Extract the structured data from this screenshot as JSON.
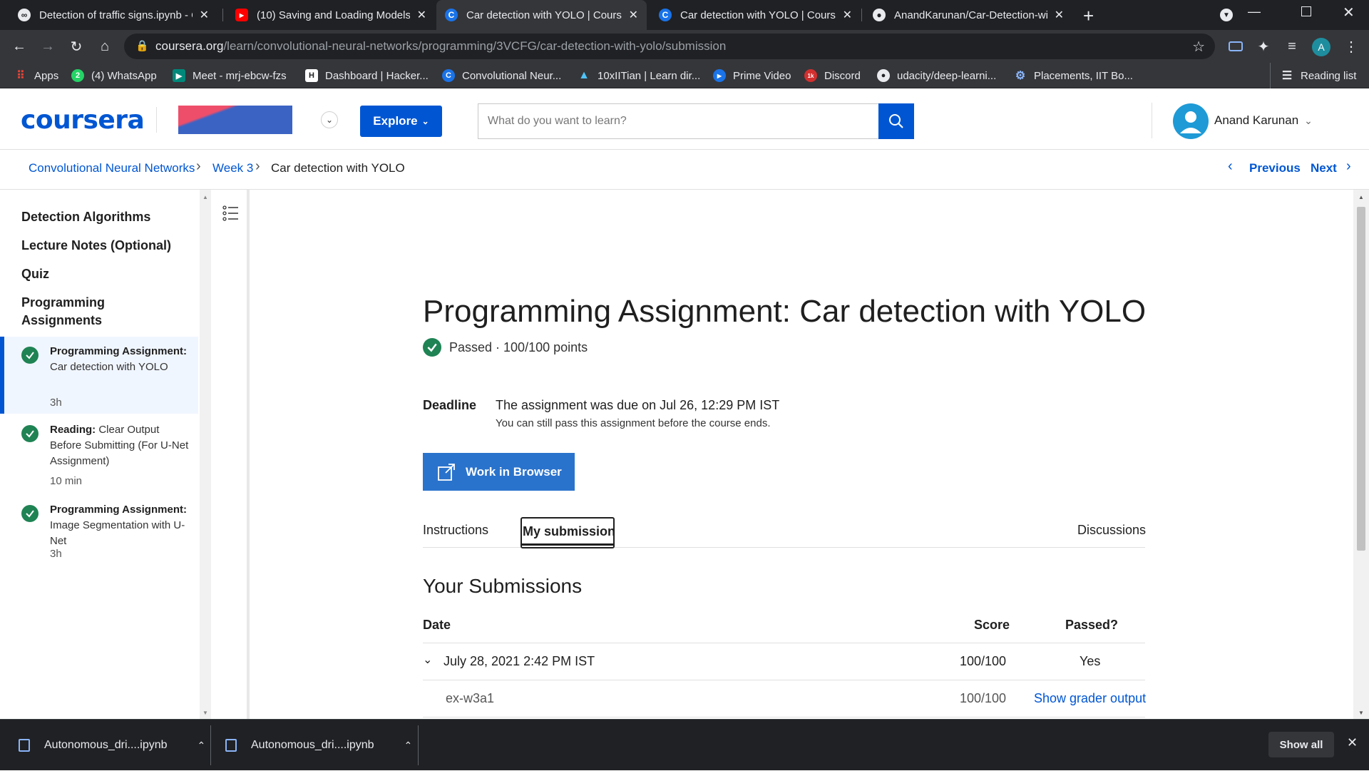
{
  "browser": {
    "tabs": [
      {
        "title": "Detection of traffic signs.ipynb - C",
        "icon": "colab-icon"
      },
      {
        "title": "(10) Saving and Loading Models",
        "icon": "youtube-icon"
      },
      {
        "title": "Car detection with YOLO | Course",
        "icon": "coursera-icon",
        "active": true
      },
      {
        "title": "Car detection with YOLO | Course",
        "icon": "coursera-icon"
      },
      {
        "title": "AnandKarunan/Car-Detection-wi",
        "icon": "github-icon"
      }
    ],
    "url_host": "coursera.org",
    "url_path": "/learn/convolutional-neural-networks/programming/3VCFG/car-detection-with-yolo/submission",
    "profile_initial": "A",
    "bookmarks": [
      {
        "label": "Apps",
        "icon": "apps-grid-icon"
      },
      {
        "label": "(4) WhatsApp",
        "icon": "whatsapp-icon",
        "badge": "2"
      },
      {
        "label": "Meet - mrj-ebcw-fzs",
        "icon": "meet-icon"
      },
      {
        "label": "Dashboard | Hacker...",
        "icon": "hackerrank-icon"
      },
      {
        "label": "Convolutional Neur...",
        "icon": "coursera-icon"
      },
      {
        "label": "10xIITian | Learn dir...",
        "icon": "triangle-icon"
      },
      {
        "label": "Prime Video",
        "icon": "prime-video-icon"
      },
      {
        "label": "Discord",
        "icon": "discord-icon"
      },
      {
        "label": "udacity/deep-learni...",
        "icon": "github-icon"
      },
      {
        "label": "Placements, IIT Bo...",
        "icon": "gear-icon"
      }
    ],
    "reading_list": "Reading list"
  },
  "header": {
    "logo": "coursera",
    "explore": "Explore",
    "search_placeholder": "What do you want to learn?",
    "user_name": "Anand Karunan"
  },
  "breadcrumb": {
    "course": "Convolutional Neural Networks",
    "week": "Week 3",
    "current": "Car detection with YOLO",
    "previous": "Previous",
    "next": "Next"
  },
  "sidebar": {
    "sections": [
      "Detection Algorithms",
      "Lecture Notes (Optional)",
      "Quiz"
    ],
    "group_title": "Programming Assignments",
    "items": [
      {
        "type": "Programming Assignment:",
        "title": "Car detection with YOLO",
        "duration": "3h"
      },
      {
        "type": "Reading:",
        "title": "Clear Output Before Submitting (For U-Net Assignment)",
        "duration": "10 min"
      },
      {
        "type": "Programming Assignment:",
        "title": "Image Segmentation with U-Net",
        "duration": "3h"
      }
    ]
  },
  "main": {
    "title": "Programming Assignment: Car detection with YOLO",
    "status": "Passed · 100/100 points",
    "deadline_label": "Deadline",
    "deadline_text": "The assignment was due on Jul 26, 12:29 PM IST",
    "deadline_sub": "You can still pass this assignment before the course ends.",
    "work_button": "Work in Browser",
    "tabs": [
      "Instructions",
      "My submission",
      "Discussions"
    ],
    "submissions_title": "Your Submissions",
    "columns": [
      "Date",
      "Score",
      "Passed?"
    ],
    "rows": [
      {
        "date": "July 28, 2021 2:42 PM IST",
        "score": "100/100",
        "passed": "Yes"
      }
    ],
    "subrows": [
      {
        "name": "ex-w3a1",
        "score": "100/100",
        "action": "Show grader output"
      }
    ]
  },
  "downloads": {
    "items": [
      "Autonomous_dri....ipynb",
      "Autonomous_dri....ipynb"
    ],
    "show_all": "Show all"
  },
  "colors": {
    "brand": "#0056d2",
    "passed_green": "#1f8354",
    "browser_dark": "#202124",
    "browser_toolbar": "#35363a"
  }
}
